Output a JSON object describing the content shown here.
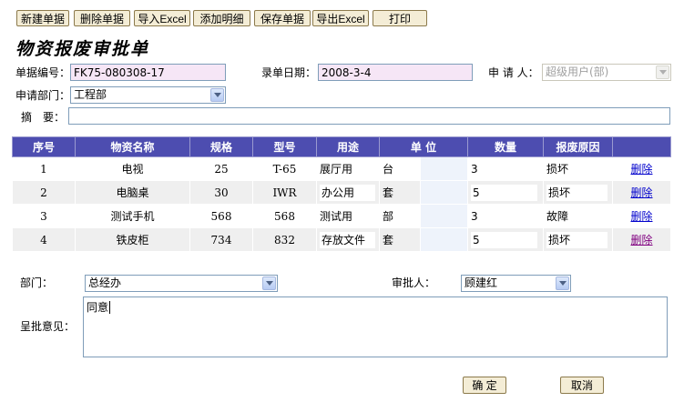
{
  "toolbar": {
    "new": "新建单据",
    "delete": "删除单据",
    "import": "导入Excel",
    "add_detail": "添加明细",
    "save": "保存单据",
    "export": "导出Excel",
    "print": "打印"
  },
  "page_title": "物资报废审批单",
  "form": {
    "doc_no_label": "单据编号：",
    "doc_no_value": "FK75-080308-17",
    "entry_date_label": "录单日期：",
    "entry_date_value": "2008-3-4",
    "applicant_label": "申 请 人：",
    "applicant_value": "超级用户(部)",
    "dept_label": "申请部门：",
    "dept_value": "工程部",
    "summary_label": "摘　要：",
    "summary_value": ""
  },
  "table": {
    "headers": [
      "序号",
      "物资名称",
      "规格",
      "型号",
      "用途",
      "单 位",
      "",
      "数量",
      "报废原因",
      ""
    ],
    "rows": [
      {
        "no": "1",
        "name": "电视",
        "spec": "25",
        "model": "T-65",
        "use": "展厅用",
        "unit": "台",
        "qty": "3",
        "reason": "损坏",
        "action": "删除"
      },
      {
        "no": "2",
        "name": "电脑桌",
        "spec": "30",
        "model": "IWR",
        "use": "办公用",
        "unit": "套",
        "qty": "5",
        "reason": "损坏",
        "action": "删除"
      },
      {
        "no": "3",
        "name": "测试手机",
        "spec": "568",
        "model": "568",
        "use": "测试用",
        "unit": "部",
        "qty": "3",
        "reason": "故障",
        "action": "删除"
      },
      {
        "no": "4",
        "name": "铁皮柜",
        "spec": "734",
        "model": "832",
        "use": "存放文件",
        "unit": "套",
        "qty": "5",
        "reason": "损坏",
        "action": "删除"
      }
    ]
  },
  "approval": {
    "dept_label": "部门：",
    "dept_value": "总经办",
    "approver_label": "审批人：",
    "approver_value": "顾建红",
    "opinion_label": "呈批意见：",
    "opinion_value": "同意"
  },
  "footer": {
    "ok": "确 定",
    "cancel": "取消"
  }
}
